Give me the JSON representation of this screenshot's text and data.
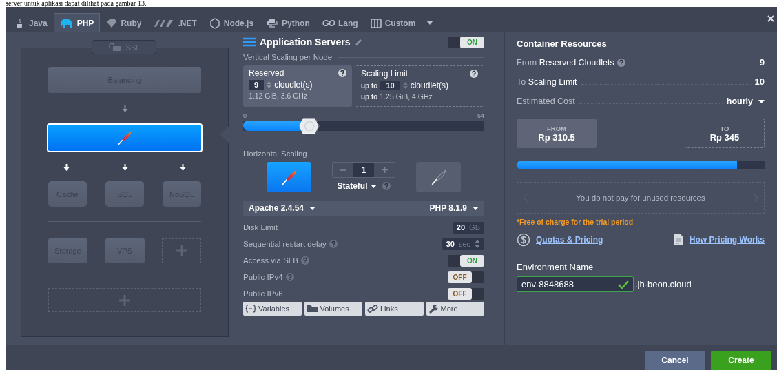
{
  "doc_caption": "server untuk aplikasi dapat dilihat pada gambar 13.",
  "tabs": [
    {
      "label": "Java",
      "selected": false
    },
    {
      "label": "PHP",
      "selected": true
    },
    {
      "label": "Ruby",
      "selected": false
    },
    {
      "label": ".NET",
      "selected": false
    },
    {
      "label": "Node.js",
      "selected": false
    },
    {
      "label": "Python",
      "selected": false
    },
    {
      "label": "Lang",
      "logo": "GO",
      "selected": false
    },
    {
      "label": "Custom",
      "selected": false
    }
  ],
  "topology": {
    "ssl": "SSL",
    "balancing": "Balancing",
    "app_server_selected": true,
    "databases": [
      "Cache",
      "SQL",
      "NoSQL"
    ],
    "extras": [
      "Storage",
      "VPS"
    ]
  },
  "node": {
    "title": "Application Servers",
    "enabled": true,
    "toggle_text": "ON",
    "vertical_scaling": "Vertical Scaling per Node",
    "reserved": {
      "label": "Reserved",
      "value": "9",
      "unit": "cloudlet(s)",
      "spec": "1.12 GiB, 3.6 GHz"
    },
    "limit": {
      "label": "Scaling Limit",
      "prefix": "up to",
      "value": "10",
      "unit": "cloudlet(s)",
      "spec_prefix": "up to",
      "spec": "1.25 GiB, 4 GHz"
    },
    "slider": {
      "min": "0",
      "max": "64",
      "level": 0.27
    },
    "horizontal_scaling": "Horizontal Scaling",
    "count": "1",
    "mode": "Stateful",
    "server": "Apache 2.4.54",
    "engine": "PHP 8.1.9",
    "settings": [
      {
        "kind": "number",
        "label": "Disk Limit",
        "help": false,
        "value": "20",
        "unit": "GB"
      },
      {
        "kind": "stepper",
        "label": "Sequential restart delay",
        "help": true,
        "value": "30",
        "unit": "sec"
      },
      {
        "kind": "toggle",
        "label": "Access via SLB",
        "help": true,
        "on": true,
        "text": "ON"
      },
      {
        "kind": "toggle",
        "label": "Public IPv4",
        "help": true,
        "on": false,
        "text": "OFF"
      },
      {
        "kind": "toggle",
        "label": "Public IPv6",
        "help": false,
        "on": false,
        "text": "OFF"
      }
    ],
    "actions": [
      {
        "kind": "variables",
        "label": "Variables"
      },
      {
        "kind": "volumes",
        "label": "Volumes"
      },
      {
        "kind": "links",
        "label": "Links"
      },
      {
        "kind": "more",
        "label": "More"
      }
    ]
  },
  "resources": {
    "title": "Container Resources",
    "rows": [
      {
        "prefix": "From",
        "label": "Reserved Cloudlets",
        "help": true,
        "value": "9"
      },
      {
        "prefix": "To",
        "label": "Scaling Limit",
        "help": false,
        "value": "10"
      }
    ],
    "cost_label": "Estimated Cost",
    "period": "hourly",
    "from": {
      "label": "FROM",
      "price": "Rp 310.5"
    },
    "to": {
      "label": "TO",
      "price": "Rp 345"
    },
    "cost_bar": {
      "level": 0.89
    },
    "note": "You do not pay for unused resources",
    "free_note": "*Free of charge for the trial period",
    "links": [
      {
        "kind": "pricing",
        "label": "Quotas & Pricing"
      },
      {
        "kind": "doc",
        "label": "How Pricing Works"
      }
    ],
    "env_label": "Environment Name",
    "env_value": "env-8848688",
    "env_valid": true,
    "domain": ".jh-beon.cloud"
  },
  "buttons": [
    {
      "kind": "cancel",
      "label": "Cancel"
    },
    {
      "kind": "create",
      "label": "Create"
    }
  ]
}
